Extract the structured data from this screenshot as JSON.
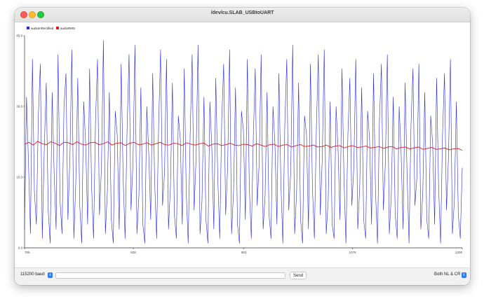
{
  "window": {
    "title": "/dev/cu.SLAB_USBtoUART"
  },
  "bottom_bar": {
    "baud_label": "115200 baud",
    "send_label": "Send",
    "line_ending_label": "Both NL & CR",
    "input_value": ""
  },
  "colors": {
    "series1": "#2a2ad6",
    "series2": "#e21b1b",
    "axis": "#333333",
    "tick_text": "#444444"
  },
  "chart_data": {
    "type": "line",
    "legend": [
      "audioInRectified",
      "audioRMS"
    ],
    "legend_placement": "top-left",
    "y_ticks": [
      "0.0",
      "15.0",
      "30.0",
      "45.0"
    ],
    "y_tick_values": [
      0,
      15,
      30,
      45
    ],
    "ylim": [
      0,
      45
    ],
    "x_ticks": [
      "705",
      "828",
      "953",
      "1076",
      "1200"
    ],
    "x_tick_values": [
      705,
      828,
      953,
      1076,
      1200
    ],
    "xlim": [
      705,
      1200
    ],
    "grid": false,
    "series": [
      {
        "name": "audioInRectified",
        "color": "#2a2ad6",
        "values": [
          4,
          32,
          18,
          3,
          40,
          12,
          5,
          28,
          39,
          2,
          21,
          35,
          8,
          1,
          33,
          16,
          4,
          41,
          10,
          3,
          30,
          37,
          6,
          19,
          42,
          2,
          14,
          36,
          9,
          1,
          31,
          22,
          5,
          38,
          13,
          2,
          27,
          40,
          7,
          17,
          44,
          3,
          12,
          33,
          6,
          1,
          29,
          24,
          4,
          39,
          15,
          2,
          25,
          41,
          8,
          18,
          43,
          3,
          11,
          34,
          5,
          1,
          30,
          20,
          6,
          37,
          14,
          2,
          26,
          42,
          9,
          16,
          40,
          4,
          13,
          35,
          7,
          2,
          28,
          23,
          5,
          38,
          12,
          1,
          24,
          41,
          8,
          19,
          43,
          3,
          10,
          32,
          6,
          1,
          31,
          21,
          4,
          36,
          15,
          2,
          27,
          39,
          7,
          17,
          42,
          3,
          12,
          34,
          5,
          1,
          29,
          25,
          6,
          40,
          13,
          2,
          23,
          38,
          9,
          18,
          41,
          4,
          11,
          33,
          7,
          2,
          30,
          22,
          5,
          37,
          14,
          1,
          26,
          40,
          8,
          16,
          43,
          3,
          12,
          35,
          6,
          1,
          28,
          24,
          4,
          39,
          13,
          2,
          25,
          41,
          7,
          19,
          42,
          3,
          10,
          31,
          5,
          2,
          30,
          21,
          6,
          38,
          15,
          1,
          24,
          36,
          9,
          17,
          40,
          4,
          13,
          34,
          6,
          2,
          29,
          23,
          5,
          37,
          12,
          1,
          27,
          39,
          8,
          18,
          41,
          3,
          11,
          32,
          7,
          2,
          30,
          20,
          4,
          35,
          16,
          1,
          26,
          38,
          9,
          15,
          39,
          4,
          12,
          33,
          6,
          2,
          28,
          22,
          5,
          36,
          13,
          1,
          24,
          37,
          8,
          19,
          40,
          3,
          10,
          31,
          7,
          2,
          17
        ]
      },
      {
        "name": "audioRMS",
        "color": "#e21b1b",
        "values": [
          22.0,
          22.4,
          21.8,
          22.6,
          22.1,
          21.9,
          22.5,
          22.2,
          21.7,
          22.4,
          22.3,
          21.9,
          22.5,
          22.0,
          21.8,
          22.3,
          22.4,
          21.9,
          22.1,
          22.5,
          21.8,
          22.2,
          22.3,
          21.7,
          22.2,
          22.4,
          21.9,
          22.0,
          22.3,
          21.8,
          22.1,
          22.4,
          21.9,
          21.8,
          22.2,
          22.1,
          21.7,
          22.3,
          22.0,
          21.8,
          22.1,
          22.2,
          21.6,
          22.0,
          22.1,
          21.7,
          21.9,
          22.2,
          21.8,
          21.7,
          22.0,
          21.9,
          21.6,
          22.1,
          21.8,
          21.5,
          21.9,
          22.0,
          21.5,
          21.8,
          21.9,
          21.4,
          21.7,
          21.9,
          21.5,
          21.6,
          21.8,
          21.4,
          21.5,
          21.8,
          21.3,
          21.6,
          21.7,
          21.2,
          21.5,
          21.7,
          21.3,
          21.4,
          21.6,
          21.2,
          21.3,
          21.5,
          21.1,
          21.4,
          21.5,
          21.0,
          21.3,
          21.4,
          21.0,
          21.2,
          21.4,
          20.9,
          21.1,
          21.3,
          20.9,
          21.0,
          21.2,
          20.8,
          21.0,
          21.1,
          20.7
        ]
      }
    ]
  }
}
